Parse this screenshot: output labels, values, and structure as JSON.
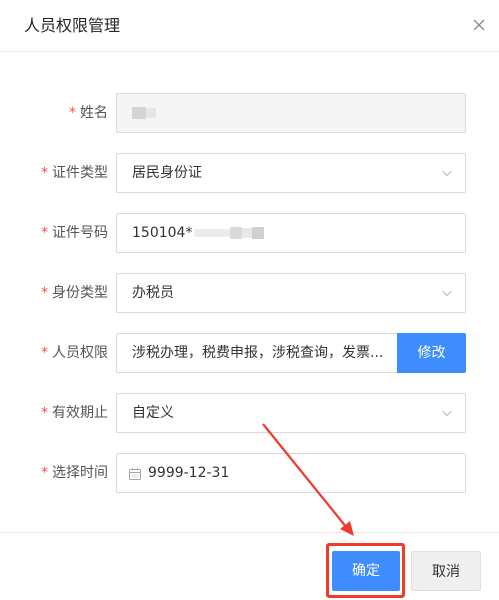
{
  "dialog": {
    "title": "人员权限管理"
  },
  "form": {
    "name": {
      "label": "姓名",
      "required_mark": "*"
    },
    "id_type": {
      "label": "证件类型",
      "required_mark": "*",
      "value": "居民身份证"
    },
    "id_number": {
      "label": "证件号码",
      "required_mark": "*",
      "value": "150104*"
    },
    "identity_type": {
      "label": "身份类型",
      "required_mark": "*",
      "value": "办税员"
    },
    "permissions": {
      "label": "人员权限",
      "required_mark": "*",
      "value": "涉税办理，税费申报，涉税查询，发票...",
      "button": "修改"
    },
    "validity": {
      "label": "有效期止",
      "required_mark": "*",
      "value": "自定义"
    },
    "select_time": {
      "label": "选择时间",
      "required_mark": "*",
      "value": "9999-12-31"
    }
  },
  "footer": {
    "confirm_label": "确定",
    "cancel_label": "取消"
  },
  "colors": {
    "primary": "#3f8cff",
    "required": "#ff4d4f",
    "annotation": "#f03a2e"
  },
  "icons": {
    "close": "close-icon",
    "dropdown": "chevron-down-icon",
    "calendar": "calendar-icon"
  }
}
